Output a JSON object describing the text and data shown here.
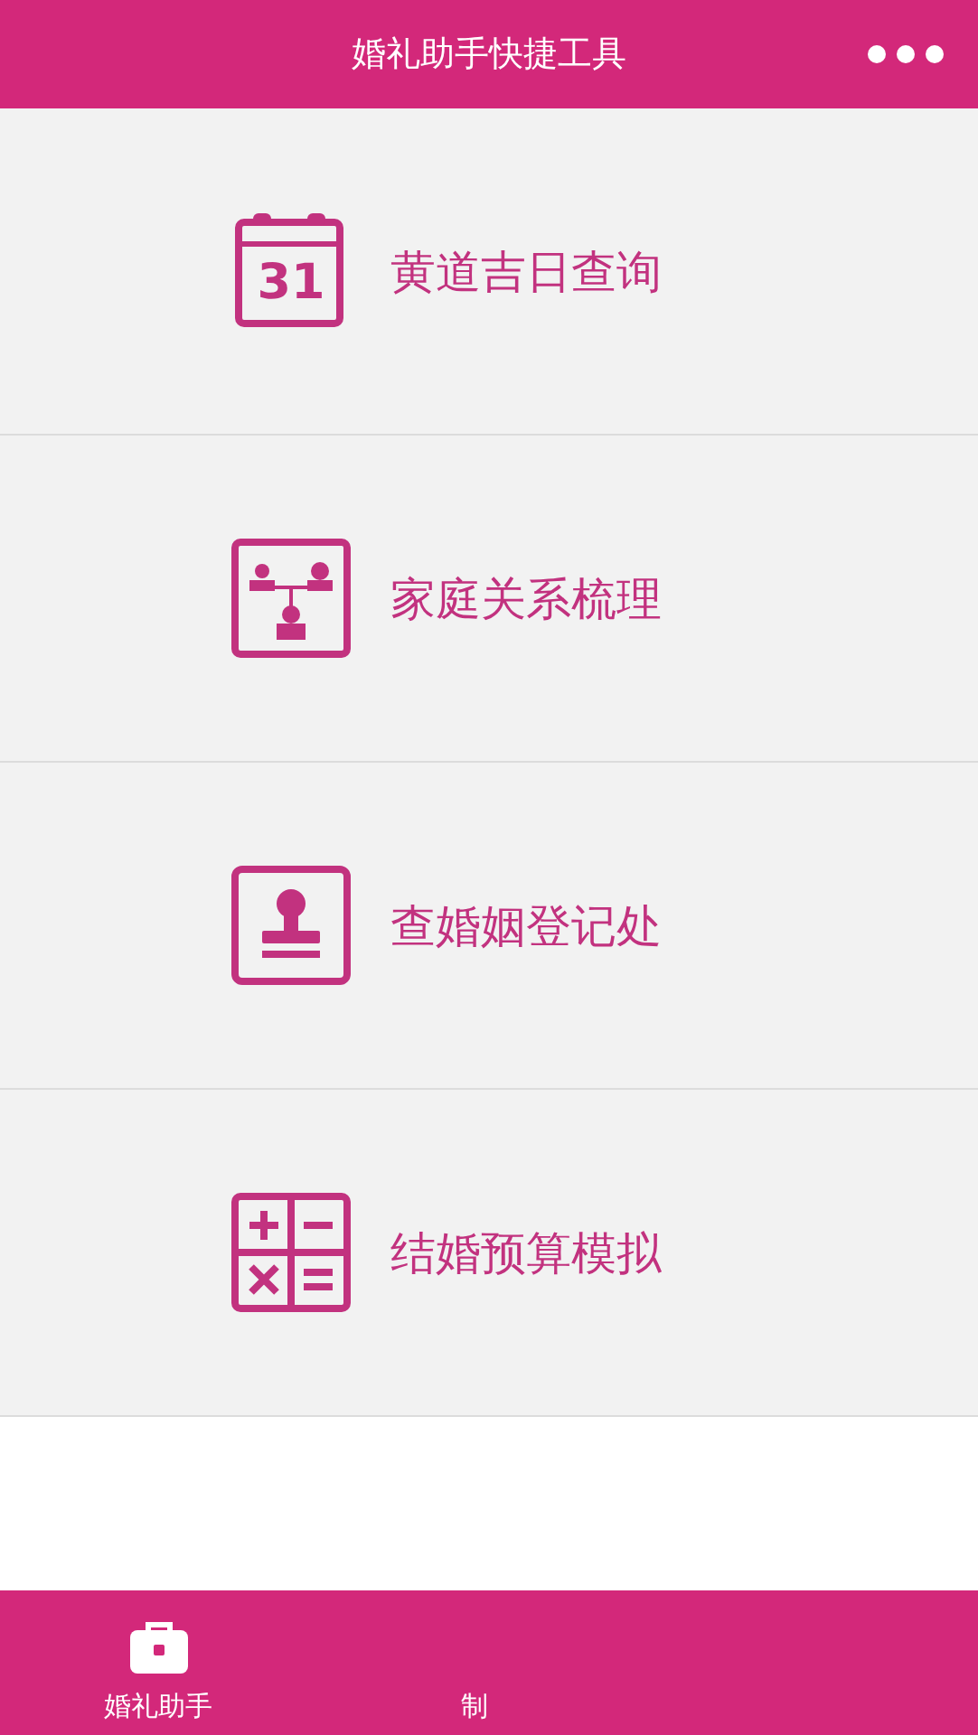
{
  "header": {
    "title": "婚礼助手快捷工具"
  },
  "items": [
    {
      "kind": "calendar",
      "label": "黄道吉日查询",
      "icon_text": "31"
    },
    {
      "kind": "family",
      "label": "家庭关系梳理"
    },
    {
      "kind": "stamp",
      "label": "查婚姻登记处"
    },
    {
      "kind": "calculator",
      "label": "结婚预算模拟"
    }
  ],
  "tabbar": [
    {
      "kind": "briefcase",
      "label": "婚礼助手"
    },
    {
      "kind": "hidden",
      "label": "制"
    }
  ]
}
